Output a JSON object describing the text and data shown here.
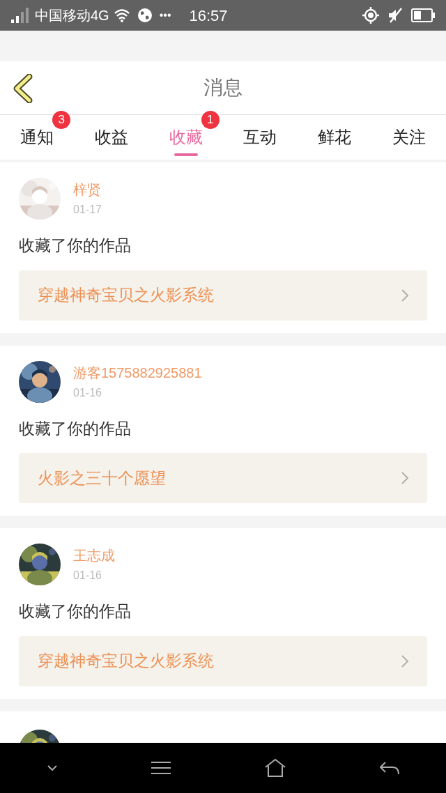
{
  "status_bar": {
    "carrier": "中国移动4G",
    "dots": "•••",
    "time": "16:57"
  },
  "header": {
    "title": "消息"
  },
  "tabs": [
    {
      "label": "通知",
      "selected": false,
      "badge": "3"
    },
    {
      "label": "收益",
      "selected": false
    },
    {
      "label": "收藏",
      "selected": true,
      "badge": "1"
    },
    {
      "label": "互动",
      "selected": false
    },
    {
      "label": "鲜花",
      "selected": false
    },
    {
      "label": "关注",
      "selected": false
    }
  ],
  "messages": [
    {
      "name": "梓贤",
      "date": "01-17",
      "text": "收藏了你的作品",
      "work": "穿越神奇宝贝之火影系统"
    },
    {
      "name": "游客1575882925881",
      "date": "01-16",
      "text": "收藏了你的作品",
      "work": "火影之三十个愿望"
    },
    {
      "name": "王志成",
      "date": "01-16",
      "text": "收藏了你的作品",
      "work": "穿越神奇宝贝之火影系统"
    }
  ]
}
